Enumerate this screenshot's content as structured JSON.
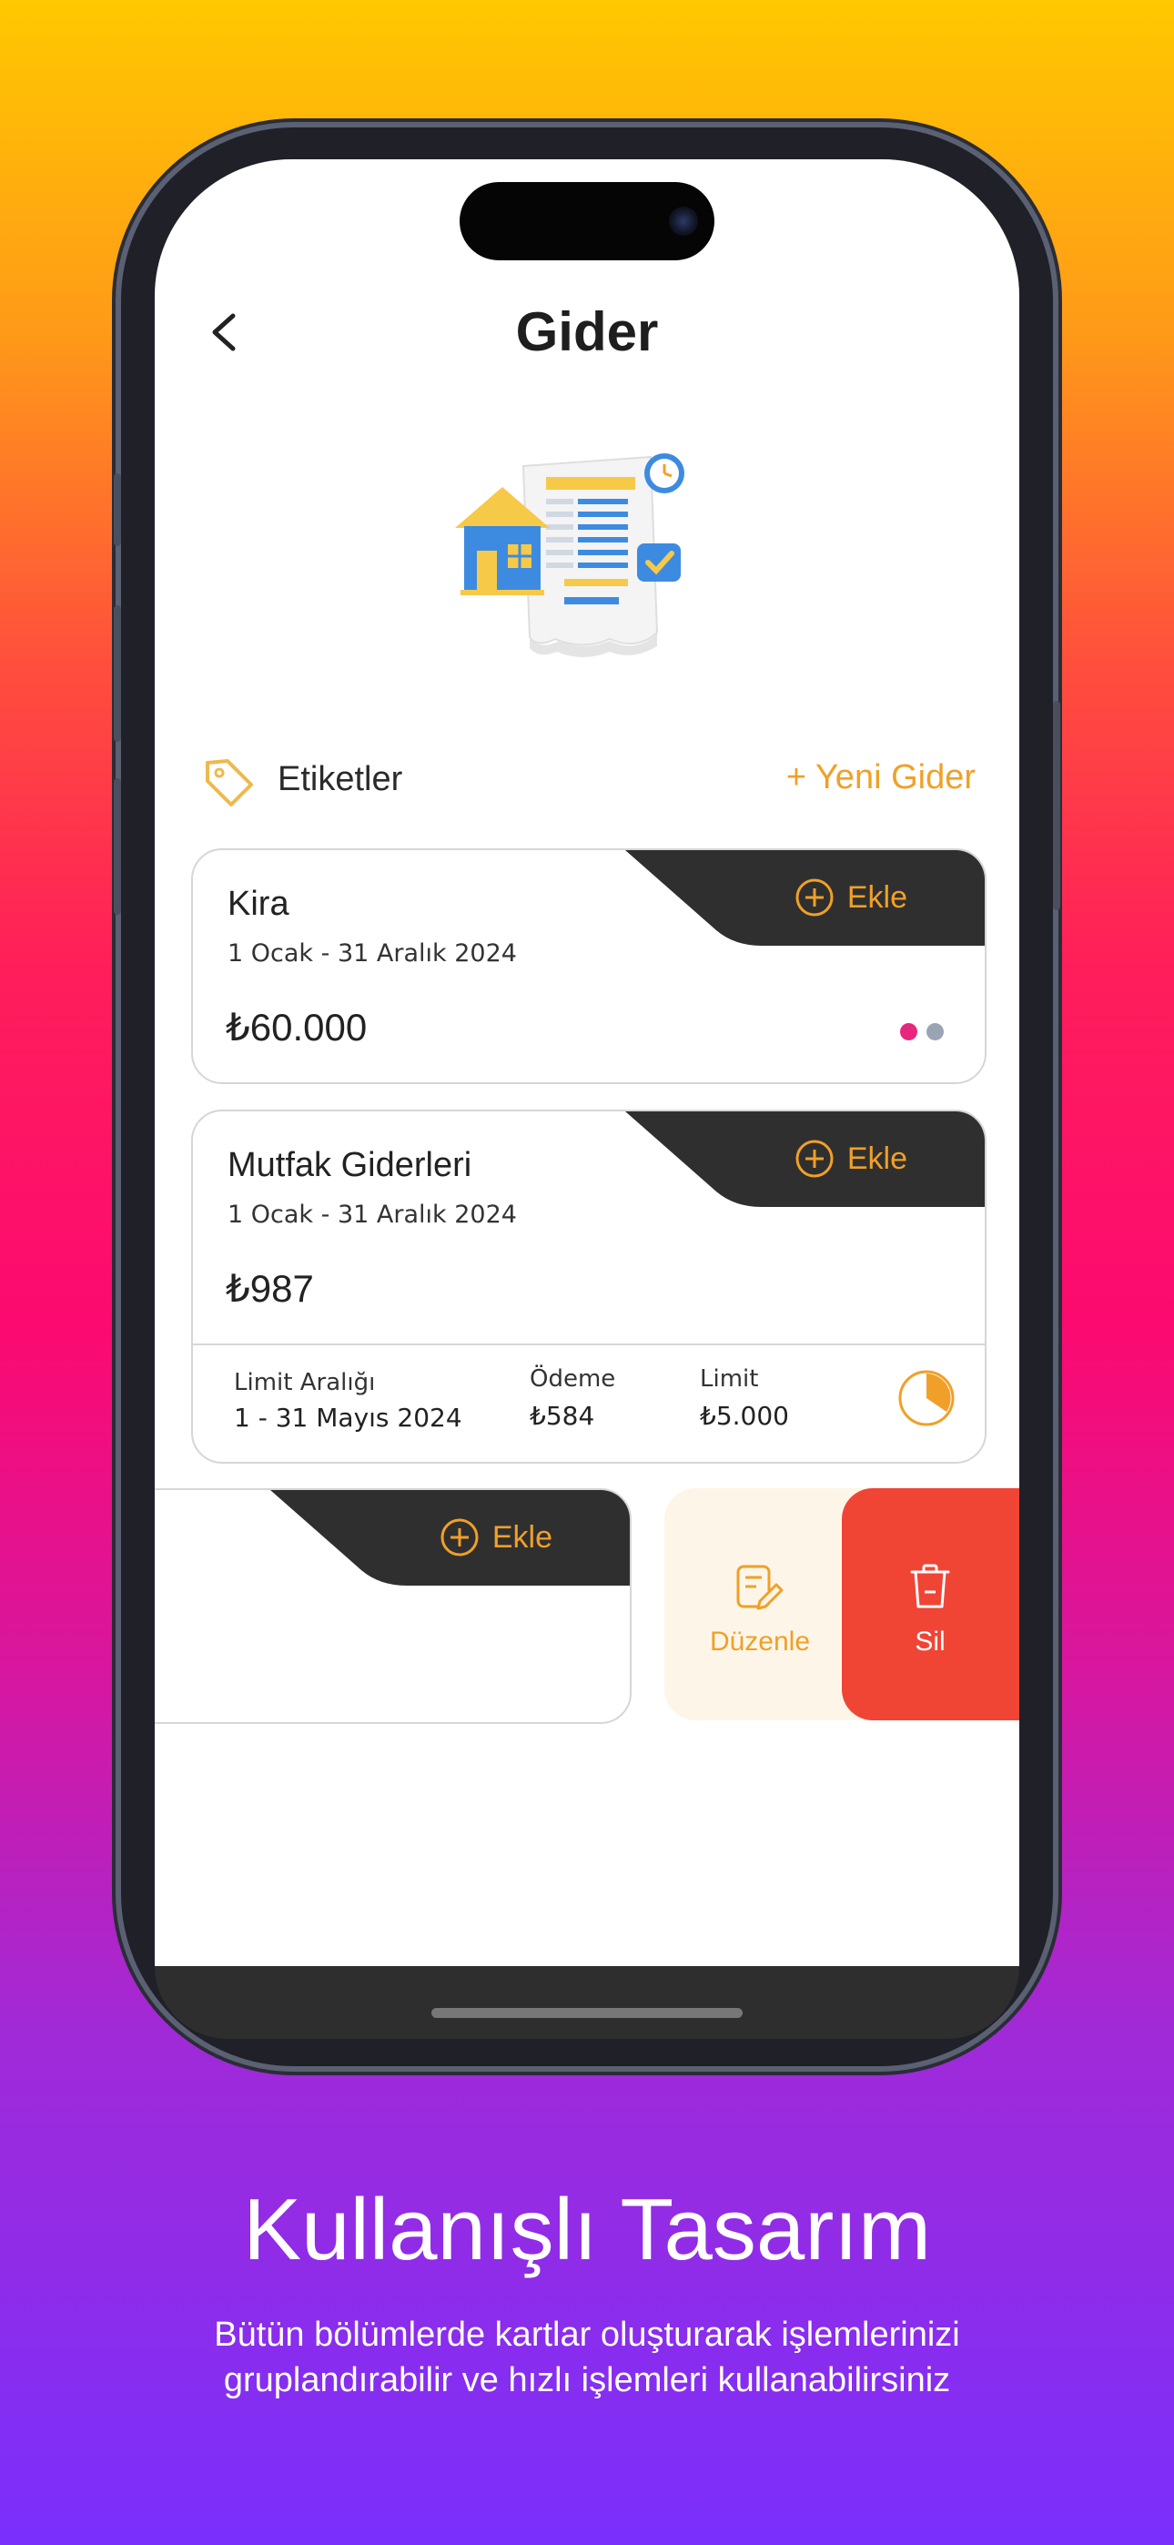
{
  "screen": {
    "title": "Gider",
    "tags_label": "Etiketler",
    "new_expense": "+ Yeni Gider"
  },
  "cards": [
    {
      "title": "Kira",
      "dates": "1 Ocak - 31 Aralık 2024",
      "amount": "₺60.000",
      "add_label": "Ekle",
      "dot_colors": [
        "#e8267e",
        "#9aa4b4"
      ]
    },
    {
      "title": "Mutfak Giderleri",
      "dates": "1 Ocak - 31 Aralık 2024",
      "amount": "₺987",
      "add_label": "Ekle",
      "limit_range_label": "Limit Aralığı",
      "limit_range_value": "1 - 31 Mayıs 2024",
      "payment_label": "Ödeme",
      "payment_value": "₺584",
      "limit_label": "Limit",
      "limit_value": "₺5.000"
    },
    {
      "add_label": "Ekle"
    }
  ],
  "swipe_actions": {
    "edit": "Düzenle",
    "delete": "Sil"
  },
  "promo": {
    "headline": "Kullanışlı Tasarım",
    "subtitle_line1": "Bütün bölümlerde kartlar oluşturarak işlemlerinizi",
    "subtitle_line2": "gruplandırabilir ve hızlı işlemleri kullanabilirsiniz"
  },
  "colors": {
    "accent": "#f0a028",
    "dark": "#2f2f2f",
    "danger": "#f04535",
    "edit_bg": "#fdf6e8"
  },
  "icons": [
    "back-icon",
    "tag-icon",
    "plus-circle-icon",
    "pie-icon",
    "edit-icon",
    "trash-icon"
  ]
}
